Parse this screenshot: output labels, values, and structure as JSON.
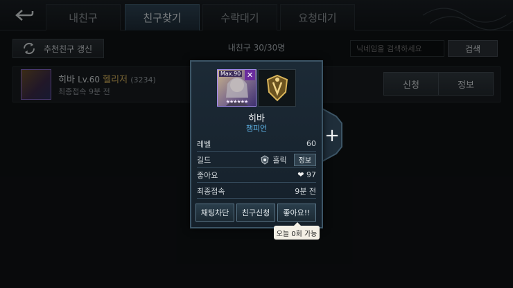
{
  "tabs": [
    {
      "label": "내친구",
      "active": false
    },
    {
      "label": "친구찾기",
      "active": true
    },
    {
      "label": "수락대기",
      "active": false
    },
    {
      "label": "요청대기",
      "active": false
    }
  ],
  "controls": {
    "refresh_label": "추천친구 갱신",
    "friend_count": "내친구 30/30명",
    "search_placeholder": "닉네임을 검색하세요",
    "search_label": "검색"
  },
  "friend_row": {
    "name": "히바",
    "level": "Lv.60",
    "class": "헬리저",
    "power": "(3234)",
    "last_login": "최종접속 9분 전",
    "apply_label": "신청",
    "info_label": "정보"
  },
  "popup": {
    "max_level_badge": "Max.90",
    "stars": "★★★★★★",
    "name": "히바",
    "class": "챔피언",
    "stats": [
      {
        "label": "레벨",
        "value": "60"
      },
      {
        "label": "길드",
        "value": "흘릭",
        "button": "정보"
      },
      {
        "label": "좋아요",
        "value": "97"
      },
      {
        "label": "최종접속",
        "value": "9분 전"
      }
    ],
    "buttons": {
      "block_chat": "채팅차단",
      "friend_request": "친구신청",
      "like": "좋아요!!"
    },
    "tooltip": "오늘 0회 가능",
    "plus": "+"
  },
  "colors": {
    "accent": "#5fb3e6",
    "active_tab": "#2f4556",
    "class_gold": "#d6b25c"
  }
}
